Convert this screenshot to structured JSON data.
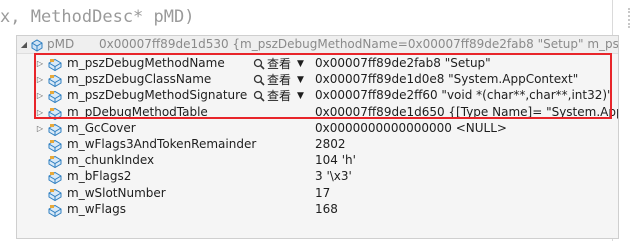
{
  "code_line": "x, MethodDesc* pMD)",
  "tooltip": {
    "header": {
      "name": "pMD",
      "value": "0x00007ff89de1d530 {m_pszDebugMethodName=0x00007ff89de2fab8 \"Setup\" m_pszDebugClassN"
    },
    "viewer_label": "查看",
    "rows": [
      {
        "name": "m_pszDebugMethodName",
        "value": "0x00007ff89de2fab8 \"Setup\"",
        "has_viewer": true,
        "expandable": true
      },
      {
        "name": "m_pszDebugClassName",
        "value": "0x00007ff89de1d0e8 \"System.AppContext\"",
        "has_viewer": true,
        "expandable": true
      },
      {
        "name": "m_pszDebugMethodSignature",
        "value": "0x00007ff89de2ff60 \"void *(char**,char**,int32)\"",
        "has_viewer": true,
        "expandable": true
      },
      {
        "name": "m_pDebugMethodTable",
        "value": "0x00007ff89de1d650 {[Type Name]= \"System.AppContex",
        "has_viewer": false,
        "expandable": true
      },
      {
        "name": "m_GcCover",
        "value": "0x0000000000000000 <NULL>",
        "has_viewer": false,
        "expandable": true
      },
      {
        "name": "m_wFlags3AndTokenRemainder",
        "value": "2802",
        "has_viewer": false,
        "expandable": false
      },
      {
        "name": "m_chunkIndex",
        "value": "104 'h'",
        "has_viewer": false,
        "expandable": false
      },
      {
        "name": "m_bFlags2",
        "value": "3 '\\x3'",
        "has_viewer": false,
        "expandable": false
      },
      {
        "name": "m_wSlotNumber",
        "value": "17",
        "has_viewer": false,
        "expandable": false
      },
      {
        "name": "m_wFlags",
        "value": "168",
        "has_viewer": false,
        "expandable": false
      }
    ]
  },
  "colors": {
    "highlight": "#e8252a",
    "field_icon": "#2f7fc1"
  }
}
